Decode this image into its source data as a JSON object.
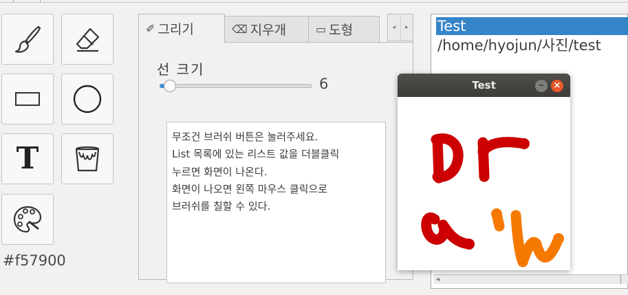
{
  "tools": {
    "brush": {
      "icon": "brush-icon"
    },
    "eraser": {
      "icon": "eraser-icon"
    },
    "rectangle": {
      "icon": "rectangle-icon"
    },
    "circle": {
      "icon": "circle-icon"
    },
    "text": {
      "icon": "text-icon",
      "glyph": "T"
    },
    "fill": {
      "icon": "paint-bucket-icon"
    },
    "palette": {
      "icon": "palette-icon"
    }
  },
  "current_color": "#f57900",
  "tabs": [
    {
      "label": "그리기",
      "icon": "pencil-icon",
      "icon_glyph": "✐"
    },
    {
      "label": "지우개",
      "icon": "eraser-icon",
      "icon_glyph": "⌫"
    },
    {
      "label": "도형",
      "icon": "rectangle-icon",
      "icon_glyph": "▭"
    }
  ],
  "tab_nav": {
    "left": "◂",
    "right": "▸"
  },
  "brush_size": {
    "label": "선 크기",
    "value": "6"
  },
  "instructions": [
    "무조건 브러쉬 버튼은 눌러주세요.",
    "List 목록에 있는 리스트 값을 더블클릭",
    "누르면 화면이 나온다.",
    "화면이 나오면 왼쪽 마우스 클릭으로",
    "브러쉬를 칠할 수 있다."
  ],
  "list": {
    "items": [
      "Test",
      "/home/hyojun/사진/test"
    ],
    "selected_index": 0,
    "scroll_left": "◂"
  },
  "popup_window": {
    "title": "Test",
    "minimize": "–",
    "close": "×",
    "drawing_colors": [
      "#cc0000",
      "#f57900"
    ]
  },
  "colors": {
    "selection": "#3584c8",
    "titlebar": "#3d3c38",
    "close_button": "#e9572b"
  }
}
